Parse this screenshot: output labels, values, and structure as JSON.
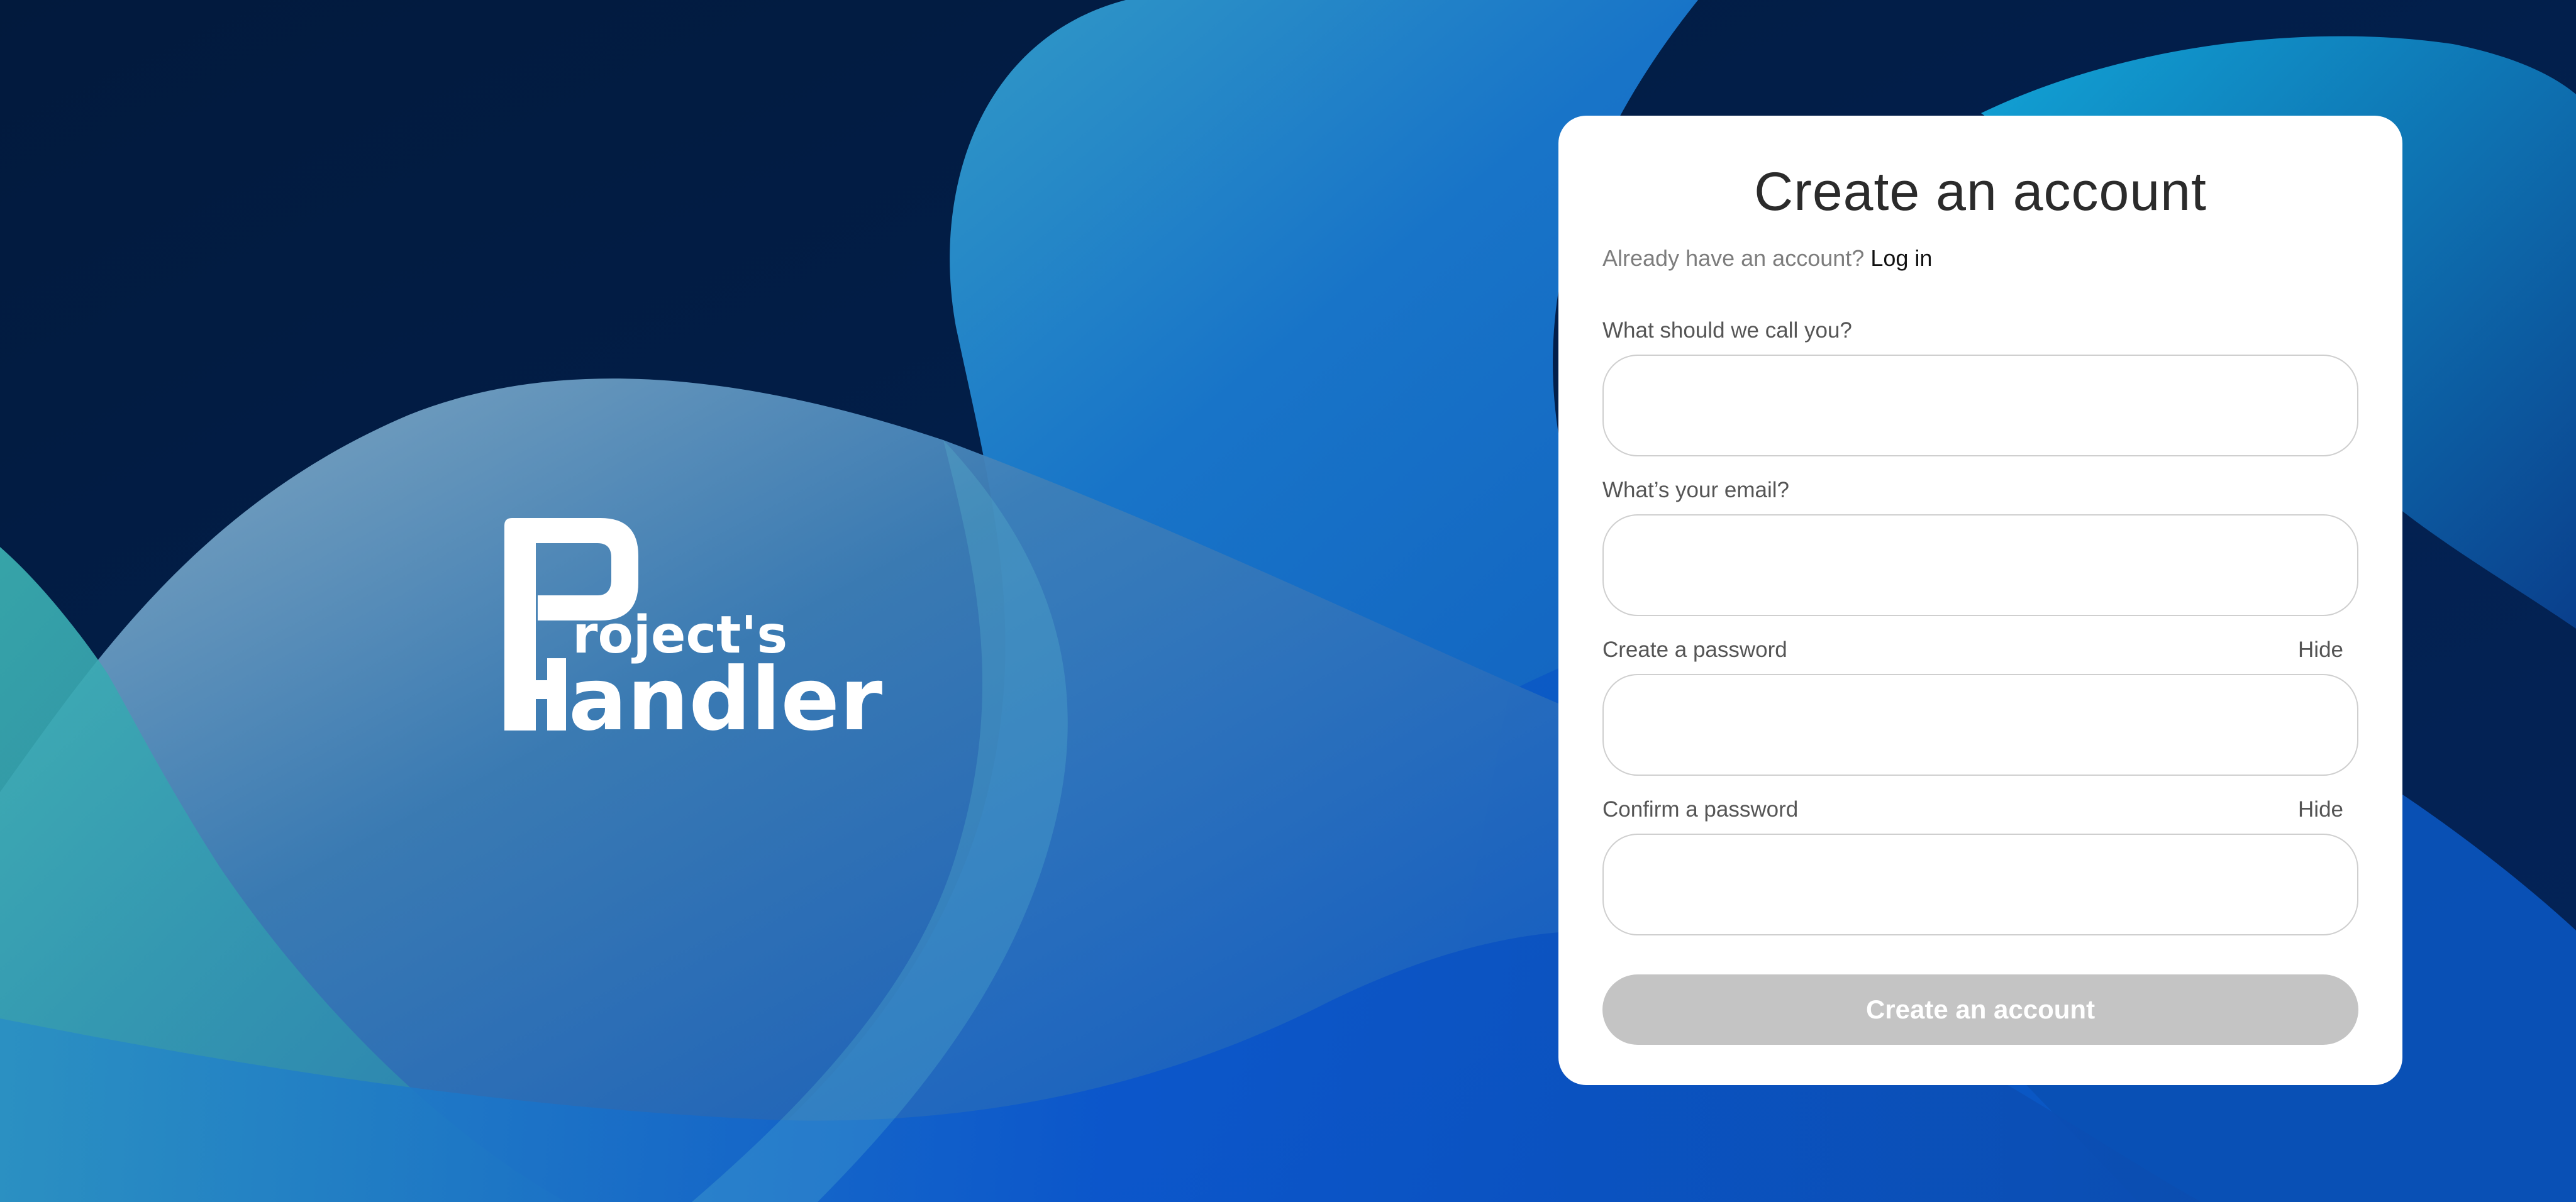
{
  "brand": {
    "logo_line1": "roject's",
    "logo_line2": "andler"
  },
  "form": {
    "title": "Create an account",
    "login_prompt": "Already have an account?",
    "login_link": "Log in",
    "fields": [
      {
        "label": "What should we call you?",
        "value": "",
        "placeholder": ""
      },
      {
        "label": "What’s your email?",
        "value": "",
        "placeholder": ""
      },
      {
        "label": "Create a password",
        "value": "",
        "placeholder": "",
        "toggle": "Hide"
      },
      {
        "label": "Confirm a password",
        "value": "",
        "placeholder": "",
        "toggle": "Hide"
      }
    ],
    "submit_label": "Create an account"
  },
  "colors": {
    "background_dark": "#02193f",
    "background_blue": "#0a5bd1",
    "accent_teal": "#3fb7c9",
    "button_disabled": "#c4c4c4",
    "card": "#ffffff"
  }
}
